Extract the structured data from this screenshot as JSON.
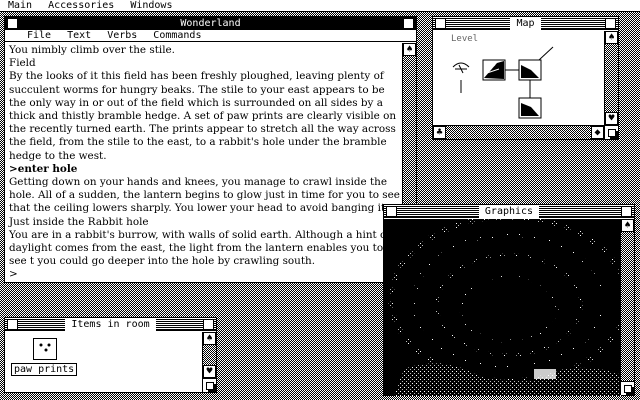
{
  "menubar": {
    "items": [
      "Main",
      "Accessories",
      "Windows"
    ]
  },
  "wonderland": {
    "title": "Wonderland",
    "menu": [
      "File",
      "Text",
      "Verbs",
      "Commands"
    ],
    "lines": [
      {
        "text": "You nimbly climb over the stile.",
        "bold": false
      },
      {
        "text": "Field",
        "bold": false
      },
      {
        "text": "By the looks of it this field has been freshly ploughed, leaving plenty of succulent worms for hungry beaks. The stile to your east appears to be the only way in or out of the field which is surrounded on all sides by a thick and thistly bramble hedge. A set of paw prints are clearly visible on the recently turned earth. The prints appear to stretch all the way across the field, from the stile to the east, to a rabbit's hole under the bramble hedge to the west.",
        "bold": false
      },
      {
        "text": ">enter hole",
        "bold": true
      },
      {
        "text": "Getting down on your hands and knees, you manage to crawl inside the hole. All of a sudden, the lantern begins to glow just in time for you to see that the ceiling lowers sharply. You lower your head to avoid banging it.",
        "bold": false
      },
      {
        "text": "Just inside the Rabbit hole",
        "bold": false
      },
      {
        "text": "You are in a rabbit's burrow, with walls of solid earth. Although a hint of daylight comes from the east, the light from the lantern enables you to see t you could go deeper into the hole by crawling south.",
        "bold": false
      },
      {
        "text": ">",
        "bold": false
      }
    ]
  },
  "map": {
    "title": "Map",
    "level_label": "Level"
  },
  "graphics": {
    "title": "Graphics"
  },
  "items": {
    "title": "Items in room",
    "item_label": "paw prints"
  },
  "icons": {
    "close": "close-box-icon",
    "zoom": "zoom-box-icon",
    "up": "scroll-up-arrow-icon",
    "down": "scroll-down-arrow-icon",
    "left": "scroll-left-arrow-icon",
    "right": "scroll-right-arrow-icon",
    "resize": "resize-box-icon"
  }
}
